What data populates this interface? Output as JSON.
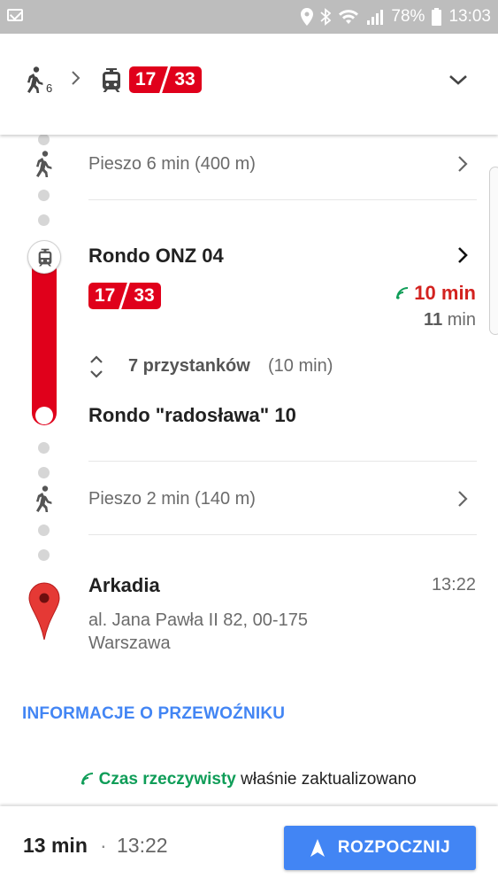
{
  "status_bar": {
    "battery_percent": "78%",
    "time": "13:03"
  },
  "header": {
    "walk_minutes": "6",
    "line_a": "17",
    "line_b": "33"
  },
  "steps": {
    "walk1": "Pieszo 6 min (400 m)",
    "board_stop": "Rondo ONZ 04",
    "line_a": "17",
    "line_b": "33",
    "realtime_duration": "10 min",
    "scheduled_num": "11",
    "scheduled_unit": "min",
    "stops_count_label": "7 przystanków",
    "stops_duration": "(10 min)",
    "alight_stop": "Rondo \"radosława\" 10",
    "walk2": "Pieszo 2 min (140 m)",
    "dest_name": "Arkadia",
    "dest_time": "13:22",
    "dest_address_line1": "al. Jana Pawła II 82, 00-175",
    "dest_address_line2": "Warszawa"
  },
  "info_link": "INFORMACJE O PRZEWOŹNIKU",
  "realtime_note": {
    "label": "Czas rzeczywisty",
    "text": "właśnie zaktualizowano"
  },
  "bottom": {
    "duration": "13 min",
    "separator": "·",
    "arrival": "13:22",
    "start_label": "ROZPOCZNIJ"
  },
  "colors": {
    "tram_red": "#e0001b",
    "link_blue": "#4285f4",
    "realtime_green": "#0f9d58",
    "realtime_red": "#d3221f"
  }
}
